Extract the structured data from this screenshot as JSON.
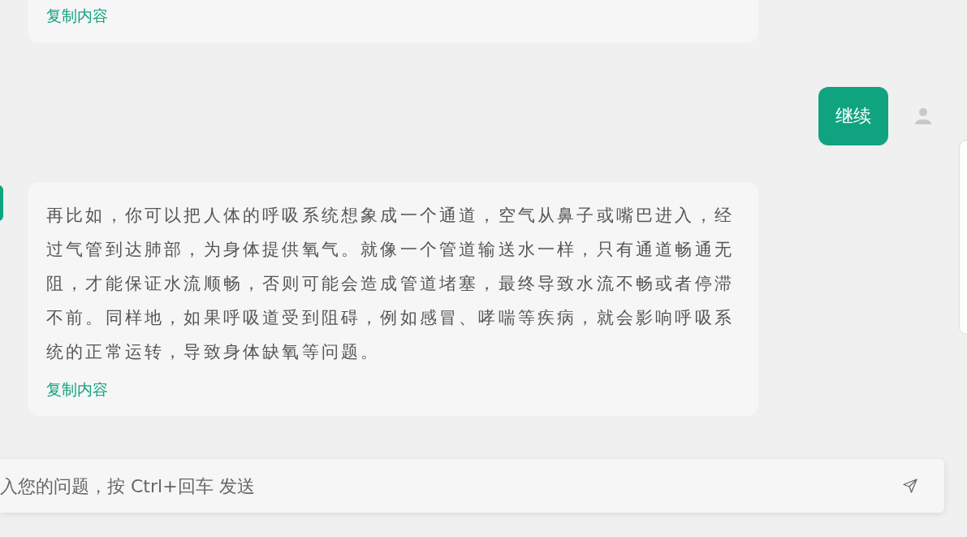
{
  "messages": [
    {
      "kind": "answer",
      "copy_label": "复制内容"
    },
    {
      "kind": "question",
      "text": "继续"
    },
    {
      "kind": "answer",
      "paragraphs": [
        "再比如，你可以把人体的呼吸系统想象成一个通道，空气从鼻子或嘴巴进入，经过气管到达肺部，为身体提供氧气。就像一个管道输送水一样，只有通道畅通无阻，才能保证水流顺畅，否则可能会造成管道堵塞，最终导致水流不畅或者停滞不前。同样地，如果呼吸道受到阻碍，例如感冒、哮喘等疾病，就会影响呼吸系统的正常运转，导致身体缺氧等问题。"
      ],
      "copy_label": "复制内容"
    }
  ],
  "input": {
    "placeholder": "入您的问题，按 Ctrl+回车 发送"
  }
}
